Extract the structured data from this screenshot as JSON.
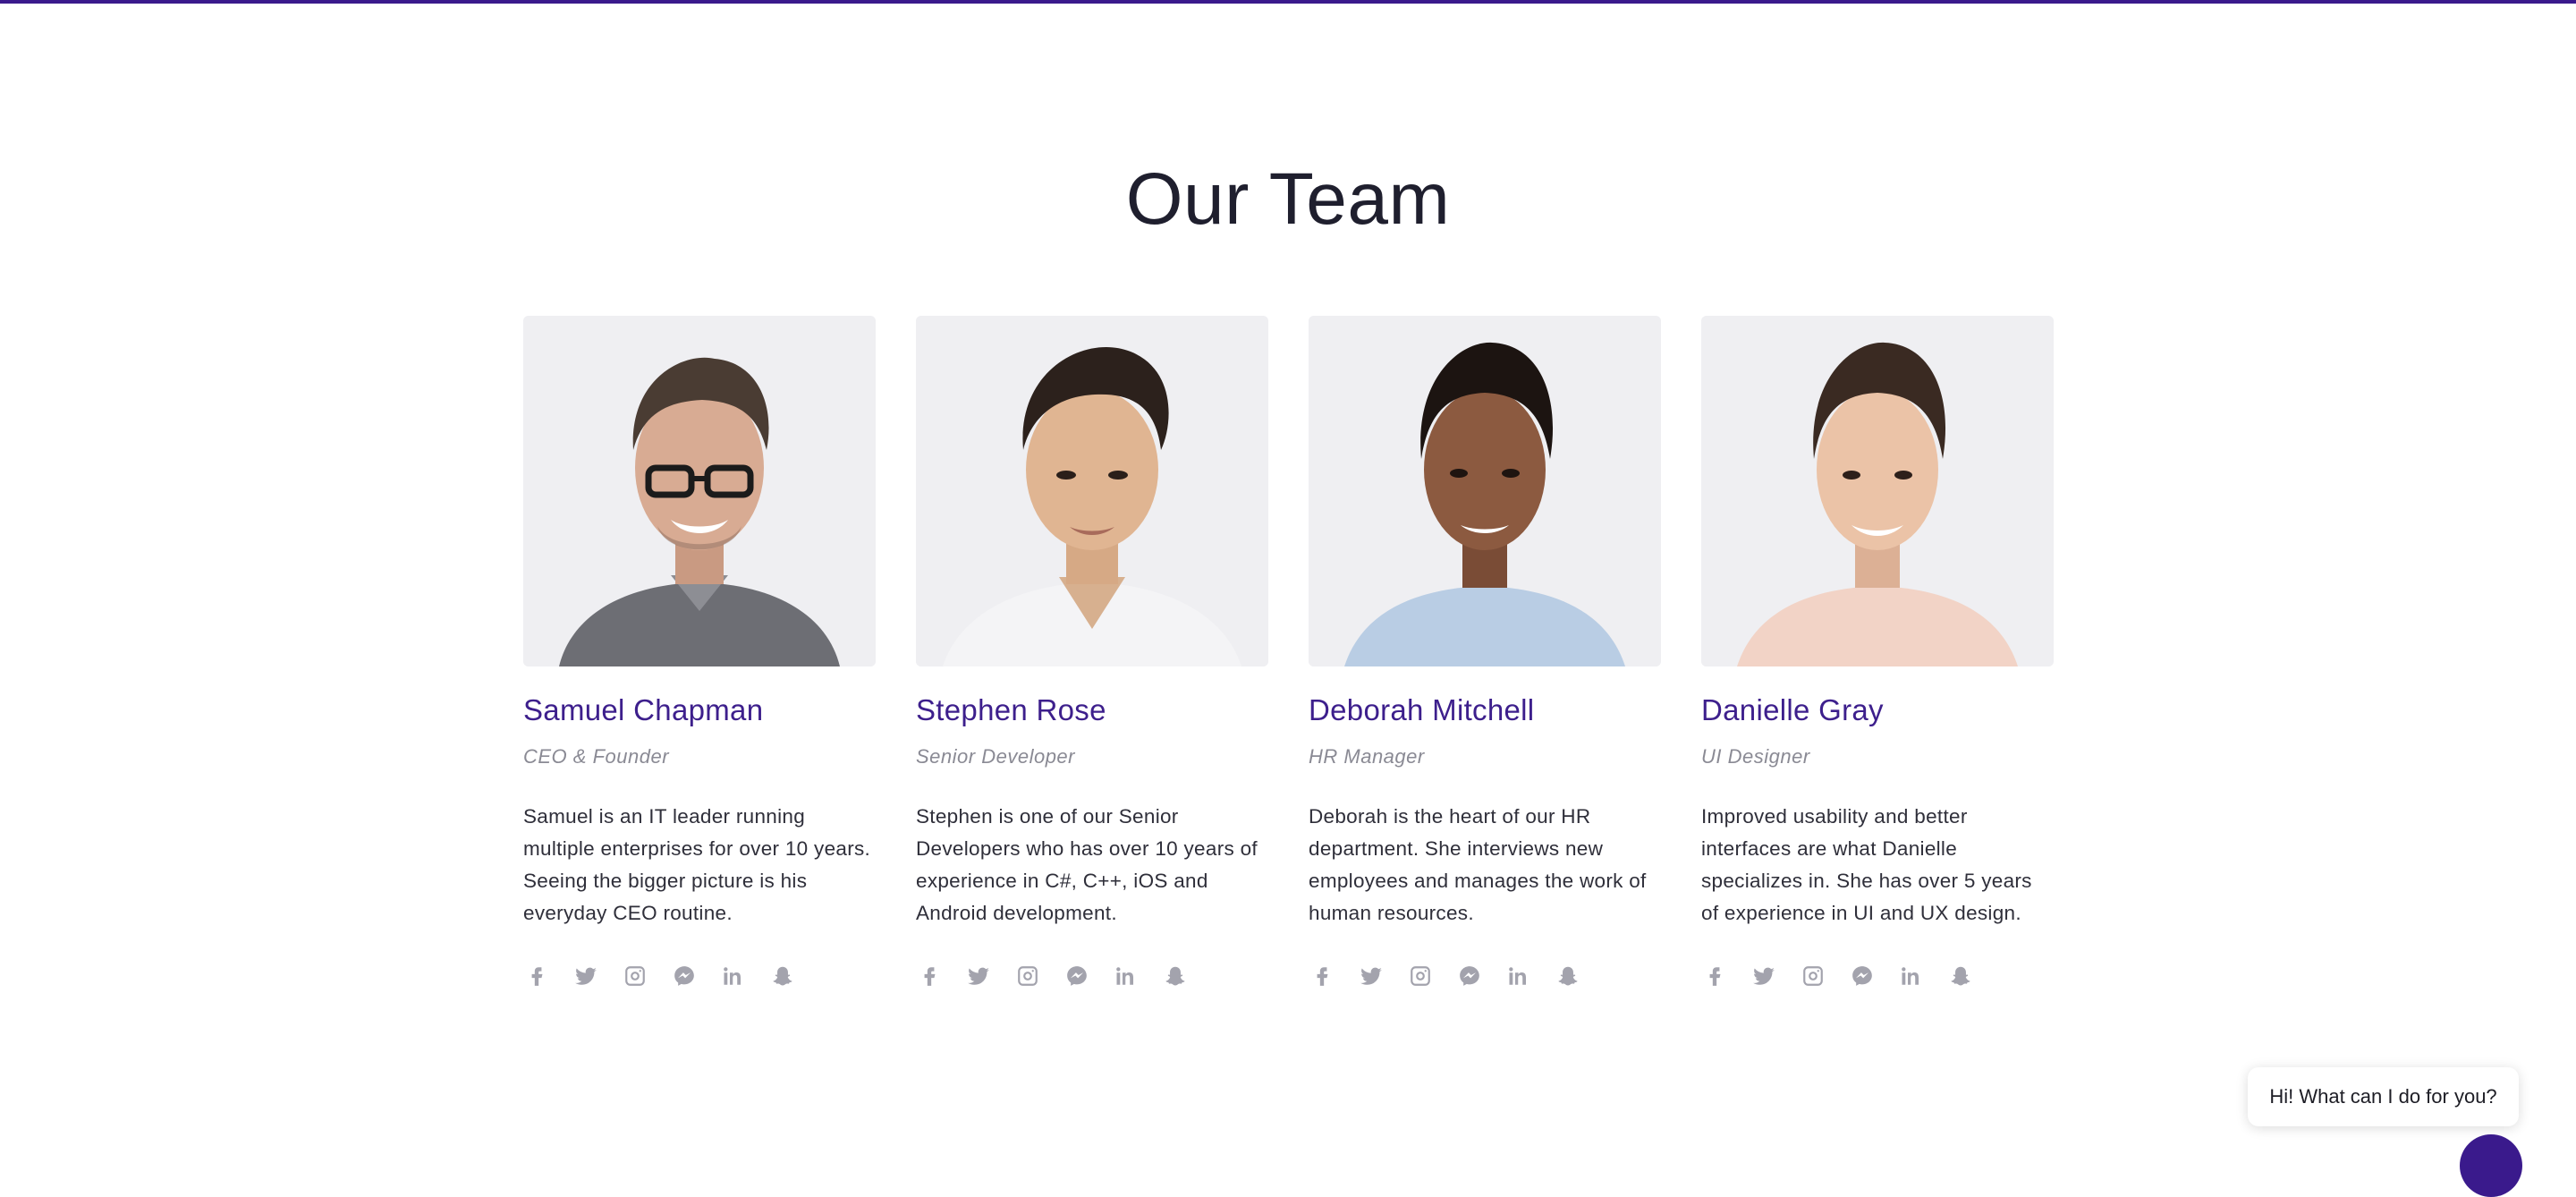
{
  "section": {
    "title": "Our Team"
  },
  "theme": {
    "accent": "#3a1a8c",
    "name_color": "#3d1f8c",
    "role_color": "#8a8a94",
    "icon_color": "#a3a3ad",
    "photo_background": "#efeff2"
  },
  "team": [
    {
      "name": "Samuel Chapman",
      "role": "CEO & Founder",
      "bio": "Samuel is an IT leader running multiple enterprises for over 10 years. Seeing the bigger picture is his everyday CEO routine.",
      "photo": "portrait-man-glasses",
      "socials": [
        "facebook-icon",
        "twitter-icon",
        "instagram-icon",
        "messenger-icon",
        "linkedin-icon",
        "snapchat-icon"
      ]
    },
    {
      "name": "Stephen Rose",
      "role": "Senior Developer",
      "bio": "Stephen is one of our Senior Developers who has over 10 years of experience in C#, C++, iOS and Android development.",
      "photo": "portrait-man-white-shirt",
      "socials": [
        "facebook-icon",
        "twitter-icon",
        "instagram-icon",
        "messenger-icon",
        "linkedin-icon",
        "snapchat-icon"
      ]
    },
    {
      "name": "Deborah Mitchell",
      "role": "HR Manager",
      "bio": "Deborah is the heart of our HR department. She interviews new employees and manages the work of human resources.",
      "photo": "portrait-woman-blue-shirt",
      "socials": [
        "facebook-icon",
        "twitter-icon",
        "instagram-icon",
        "messenger-icon",
        "linkedin-icon",
        "snapchat-icon"
      ]
    },
    {
      "name": "Danielle Gray",
      "role": "UI Designer",
      "bio": "Improved usability and better interfaces are what Danielle specializes in. She has over 5 years of experience in UI and UX design.",
      "photo": "portrait-woman-pink-shirt",
      "socials": [
        "facebook-icon",
        "twitter-icon",
        "instagram-icon",
        "messenger-icon",
        "linkedin-icon",
        "snapchat-icon"
      ]
    }
  ],
  "chat": {
    "message": "Hi! What can I do for you?",
    "button_icon": "chat-icon"
  }
}
